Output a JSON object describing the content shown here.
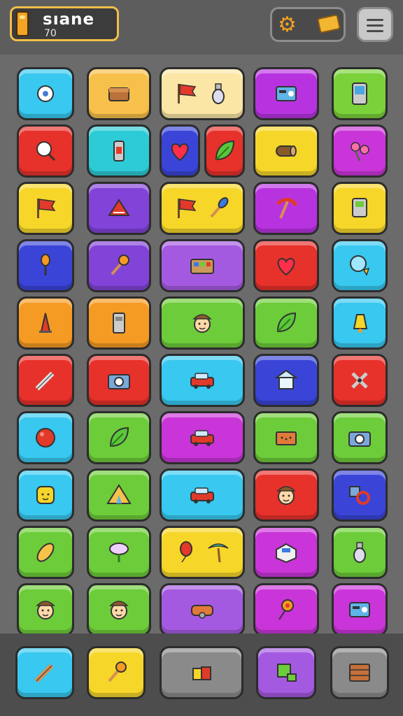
{
  "header": {
    "player_name": "sıane",
    "score": "70",
    "menu_icon": "hamburger-menu-icon",
    "settings_icon": "gear-icon",
    "shop_icon": "treasure-chest-icon"
  },
  "grid": {
    "rows": [
      [
        {
          "color": "#38c8f0",
          "icons": [
            "gear-icon"
          ]
        },
        {
          "color": "#f7c04a",
          "icons": [
            "chest-icon"
          ]
        },
        {
          "color": "#fbe6a5",
          "icons": [
            "flag-icon",
            "bottle-icon"
          ]
        },
        {
          "color": "#b833e0",
          "icons": [
            "radio-icon"
          ]
        },
        {
          "color": "#7ad13a",
          "icons": [
            "tablet-icon"
          ]
        }
      ],
      [
        {
          "color": "#e7312b",
          "icons": [
            "magnifier-icon"
          ]
        },
        {
          "color": "#2ccbd6",
          "icons": [
            "phone-icon"
          ]
        },
        {
          "color": "#3a45d8",
          "icons": [
            "heart-icon"
          ],
          "split": "#e7312b",
          "split_icons": [
            "leaf-icon"
          ]
        },
        {
          "color": "#f6d629",
          "icons": [
            "log-icon"
          ]
        },
        {
          "color": "#c935d8",
          "icons": [
            "flowers-icon"
          ]
        }
      ],
      [
        {
          "color": "#f6d629",
          "icons": [
            "flag-icon"
          ]
        },
        {
          "color": "#8243d8",
          "icons": [
            "scarf-icon"
          ]
        },
        {
          "color": "#f6d629",
          "icons": [
            "flag-icon",
            "brush-icon"
          ]
        },
        {
          "color": "#b833e0",
          "icons": [
            "pickaxe-icon"
          ]
        },
        {
          "color": "#f6d629",
          "icons": [
            "meter-icon"
          ]
        }
      ],
      [
        {
          "color": "#3a45d8",
          "icons": [
            "torch-icon"
          ]
        },
        {
          "color": "#8243d8",
          "icons": [
            "microphone-icon"
          ]
        },
        {
          "color": "#a45ae0",
          "icons": [
            "palette-icon"
          ]
        },
        {
          "color": "#e7312b",
          "icons": [
            "heart-icon"
          ]
        },
        {
          "color": "#38c8f0",
          "icons": [
            "mirror-icon"
          ]
        }
      ],
      [
        {
          "color": "#f59a23",
          "icons": [
            "cone-icon"
          ]
        },
        {
          "color": "#f59a23",
          "icons": [
            "device-icon"
          ]
        },
        {
          "color": "#6dcc3a",
          "icons": [
            "face-icon"
          ]
        },
        {
          "color": "#6dcc3a",
          "icons": [
            "leaf-icon"
          ]
        },
        {
          "color": "#38c8f0",
          "icons": [
            "bell-icon"
          ]
        }
      ],
      [
        {
          "color": "#e7312b",
          "icons": [
            "pencil-icon"
          ]
        },
        {
          "color": "#e7312b",
          "icons": [
            "camera-icon"
          ]
        },
        {
          "color": "#38c8f0",
          "icons": [
            "car-icon"
          ]
        },
        {
          "color": "#3a45d8",
          "icons": [
            "gazebo-icon"
          ]
        },
        {
          "color": "#e7312b",
          "icons": [
            "pin-icon"
          ]
        }
      ],
      [
        {
          "color": "#38c8f0",
          "icons": [
            "ball-icon"
          ]
        },
        {
          "color": "#6dcc3a",
          "icons": [
            "leaf-icon"
          ]
        },
        {
          "color": "#c935d8",
          "icons": [
            "car-icon"
          ]
        },
        {
          "color": "#6dcc3a",
          "icons": [
            "brick-icon"
          ]
        },
        {
          "color": "#6dcc3a",
          "icons": [
            "camera-icon"
          ]
        }
      ],
      [
        {
          "color": "#38c8f0",
          "icons": [
            "pot-icon"
          ]
        },
        {
          "color": "#6dcc3a",
          "icons": [
            "tent-icon"
          ]
        },
        {
          "color": "#38c8f0",
          "icons": [
            "car-icon"
          ]
        },
        {
          "color": "#e7312b",
          "icons": [
            "face-icon"
          ]
        },
        {
          "color": "#3a45d8",
          "icons": [
            "ring-icon"
          ]
        }
      ],
      [
        {
          "color": "#6dcc3a",
          "icons": [
            "bullet-icon"
          ]
        },
        {
          "color": "#6dcc3a",
          "icons": [
            "tree-icon"
          ]
        },
        {
          "color": "#f6d629",
          "icons": [
            "balloon-icon",
            "palm-icon"
          ]
        },
        {
          "color": "#c935d8",
          "icons": [
            "box-icon"
          ]
        },
        {
          "color": "#6dcc3a",
          "icons": [
            "bottle-icon"
          ]
        }
      ],
      [
        {
          "color": "#6dcc3a",
          "icons": [
            "face-icon"
          ]
        },
        {
          "color": "#6dcc3a",
          "icons": [
            "face-icon"
          ]
        },
        {
          "color": "#a45ae0",
          "icons": [
            "sofa-icon"
          ]
        },
        {
          "color": "#c935d8",
          "icons": [
            "flower-icon"
          ]
        },
        {
          "color": "#c935d8",
          "icons": [
            "radio-icon"
          ]
        }
      ]
    ]
  },
  "tray": [
    {
      "color": "#38c8f0",
      "icons": [
        "carrot-icon"
      ]
    },
    {
      "color": "#f6d629",
      "icons": [
        "microphone-icon"
      ]
    },
    {
      "color": "#8a8a8a",
      "icons": [
        "blocks-icon"
      ]
    },
    {
      "color": "#a45ae0",
      "icons": [
        "cube-icon"
      ]
    },
    {
      "color": "#8a8a8a",
      "icons": [
        "crate-icon"
      ]
    }
  ]
}
